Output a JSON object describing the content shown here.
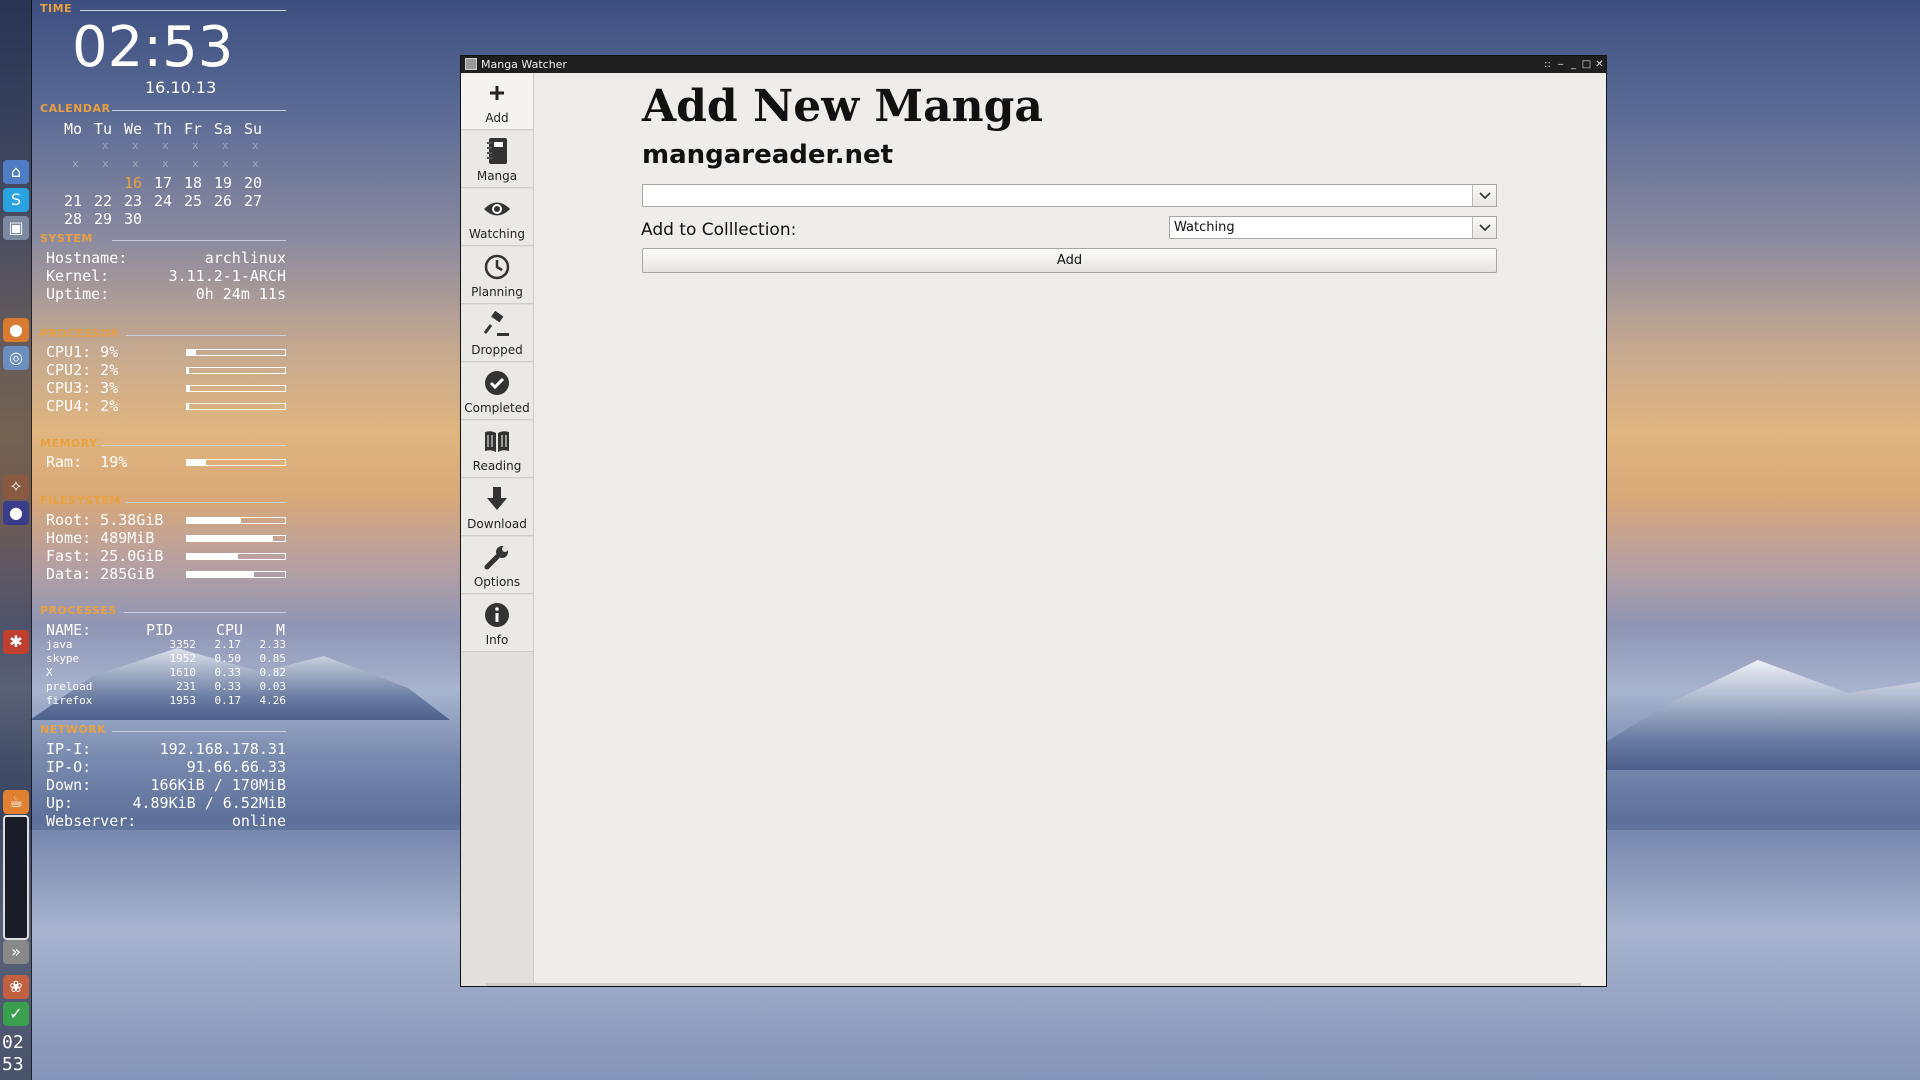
{
  "conky": {
    "time_header": "TIME",
    "clock": "02:53",
    "date": "16.10.13",
    "calendar_header": "CALENDAR",
    "weekdays": [
      "Mo",
      "Tu",
      "We",
      "Th",
      "Fr",
      "Sa",
      "Su"
    ],
    "calendar_rows": [
      [
        "",
        "x",
        "x",
        "x",
        "x",
        "x",
        "x"
      ],
      [
        "x",
        "x",
        "x",
        "x",
        "x",
        "x",
        "x"
      ],
      [
        "",
        "",
        "16",
        "17",
        "18",
        "19",
        "20"
      ],
      [
        "21",
        "22",
        "23",
        "24",
        "25",
        "26",
        "27"
      ],
      [
        "28",
        "29",
        "30",
        "",
        "",
        "",
        ""
      ]
    ],
    "today": "16",
    "system_header": "SYSTEM",
    "system": [
      {
        "label": "Hostname:",
        "value": "archlinux"
      },
      {
        "label": "Kernel:",
        "value": "3.11.2-1-ARCH"
      },
      {
        "label": "Uptime:",
        "value": "0h 24m 11s"
      }
    ],
    "processor_header": "PROCESSOR",
    "cpus": [
      {
        "label": "CPU1: 9%",
        "percent": 9
      },
      {
        "label": "CPU2: 2%",
        "percent": 2
      },
      {
        "label": "CPU3: 3%",
        "percent": 3
      },
      {
        "label": "CPU4: 2%",
        "percent": 2
      }
    ],
    "memory_header": "MEMORY",
    "ram": {
      "label": "Ram:  19%",
      "percent": 19
    },
    "filesystem_header": "FILESYSTEM",
    "filesystems": [
      {
        "label": "Root: 5.38GiB",
        "percent": 55
      },
      {
        "label": "Home: 489MiB",
        "percent": 88
      },
      {
        "label": "Fast: 25.0GiB",
        "percent": 52
      },
      {
        "label": "Data: 285GiB",
        "percent": 68
      }
    ],
    "processes_header": "PROCESSES",
    "proc_columns": [
      "NAME:",
      "PID",
      "CPU",
      "M"
    ],
    "processes": [
      {
        "name": "java",
        "pid": "3352",
        "cpu": "2.17",
        "mem": "2.33"
      },
      {
        "name": "skype",
        "pid": "1952",
        "cpu": "0.50",
        "mem": "0.85"
      },
      {
        "name": "X",
        "pid": "1610",
        "cpu": "0.33",
        "mem": "0.82"
      },
      {
        "name": "preload",
        "pid": "231",
        "cpu": "0.33",
        "mem": "0.03"
      },
      {
        "name": "firefox",
        "pid": "1953",
        "cpu": "0.17",
        "mem": "4.26"
      }
    ],
    "network_header": "NETWORK",
    "network": [
      {
        "label": "IP-I:",
        "value": "192.168.178.31"
      },
      {
        "label": "IP-O:",
        "value": "91.66.66.33"
      },
      {
        "label": "Down:",
        "value": "166KiB / 170MiB"
      },
      {
        "label": "Up:",
        "value": "4.89KiB / 6.52MiB"
      },
      {
        "label": "Webserver:",
        "value": "online"
      }
    ]
  },
  "dock": {
    "clock_hour": "02",
    "clock_min": "53",
    "icons": [
      "home-icon",
      "skype-icon",
      "screenshot-icon",
      "firefox-icon",
      "browser-icon",
      "cat-icon",
      "eclipse-icon",
      "puzzle-icon",
      "java-icon",
      "arrows-icon",
      "shell-icon",
      "check-icon"
    ]
  },
  "window": {
    "title": "Manga Watcher",
    "controls": [
      "::",
      "‒",
      "_",
      "□",
      "✕"
    ]
  },
  "sidebar": {
    "items": [
      {
        "label": "Add",
        "icon": "plus-icon"
      },
      {
        "label": "Manga",
        "icon": "notebook-icon"
      },
      {
        "label": "Watching",
        "icon": "eye-icon"
      },
      {
        "label": "Planning",
        "icon": "clock-icon"
      },
      {
        "label": "Dropped",
        "icon": "gavel-icon"
      },
      {
        "label": "Completed",
        "icon": "checkmark-icon"
      },
      {
        "label": "Reading",
        "icon": "book-icon"
      },
      {
        "label": "Download",
        "icon": "download-arrow-icon"
      },
      {
        "label": "Options",
        "icon": "wrench-icon"
      },
      {
        "label": "Info",
        "icon": "info-icon"
      }
    ]
  },
  "main": {
    "title": "Add New Manga",
    "source": "mangareader.net",
    "manga_select_value": "",
    "collection_label": "Add to Colllection:",
    "collection_value": "Watching",
    "add_button": "Add"
  },
  "colors": {
    "conky_header": "#e8a040",
    "today": "#e8a040",
    "titlebar": "#1f1f1f",
    "window_bg": "#efedea"
  }
}
